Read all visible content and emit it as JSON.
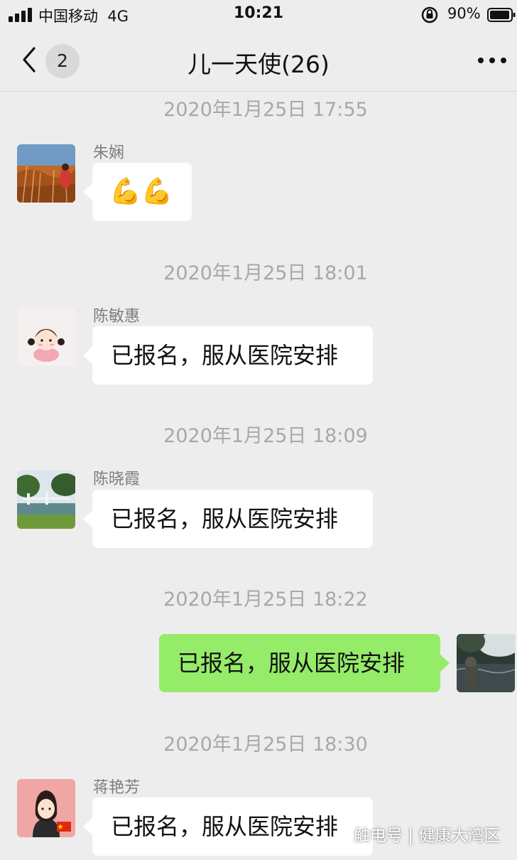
{
  "status_bar": {
    "carrier": "中国移动",
    "network": "4G",
    "time": "10:21",
    "battery": "90%",
    "icons": [
      "signal-icon",
      "rotation-lock-icon",
      "battery-icon"
    ]
  },
  "nav": {
    "unread_count": "2",
    "title": "儿一天使(26)",
    "icons": [
      "back-chevron-icon",
      "more-icon"
    ]
  },
  "messages": [
    {
      "timestamp": "2020年1月25日 17:55",
      "sender": "朱娴",
      "text": "💪💪",
      "side": "left",
      "avatar": "field-photo-avatar"
    },
    {
      "timestamp": "2020年1月25日 18:01",
      "sender": "陈敏惠",
      "text": "已报名，服从医院安排",
      "side": "left",
      "avatar": "cartoon-girl-avatar"
    },
    {
      "timestamp": "2020年1月25日 18:09",
      "sender": "陈晓霞",
      "text": "已报名，服从医院安排",
      "side": "left",
      "avatar": "bridge-photo-avatar"
    },
    {
      "timestamp": "2020年1月25日 18:22",
      "sender": "",
      "text": "已报名，服从医院安排",
      "side": "right",
      "avatar": "lake-photo-avatar"
    },
    {
      "timestamp": "2020年1月25日 18:30",
      "sender": "蒋艳芳",
      "text": "已报名，服从医院安排",
      "side": "left",
      "avatar": "cartoon-woman-avatar"
    }
  ],
  "watermark": "触电号 | 健康大湾区",
  "colors": {
    "background": "#ededed",
    "bubble_left": "#ffffff",
    "bubble_right": "#95ec69",
    "timestamp": "#a8a8a8",
    "sender": "#7d7d7d"
  }
}
